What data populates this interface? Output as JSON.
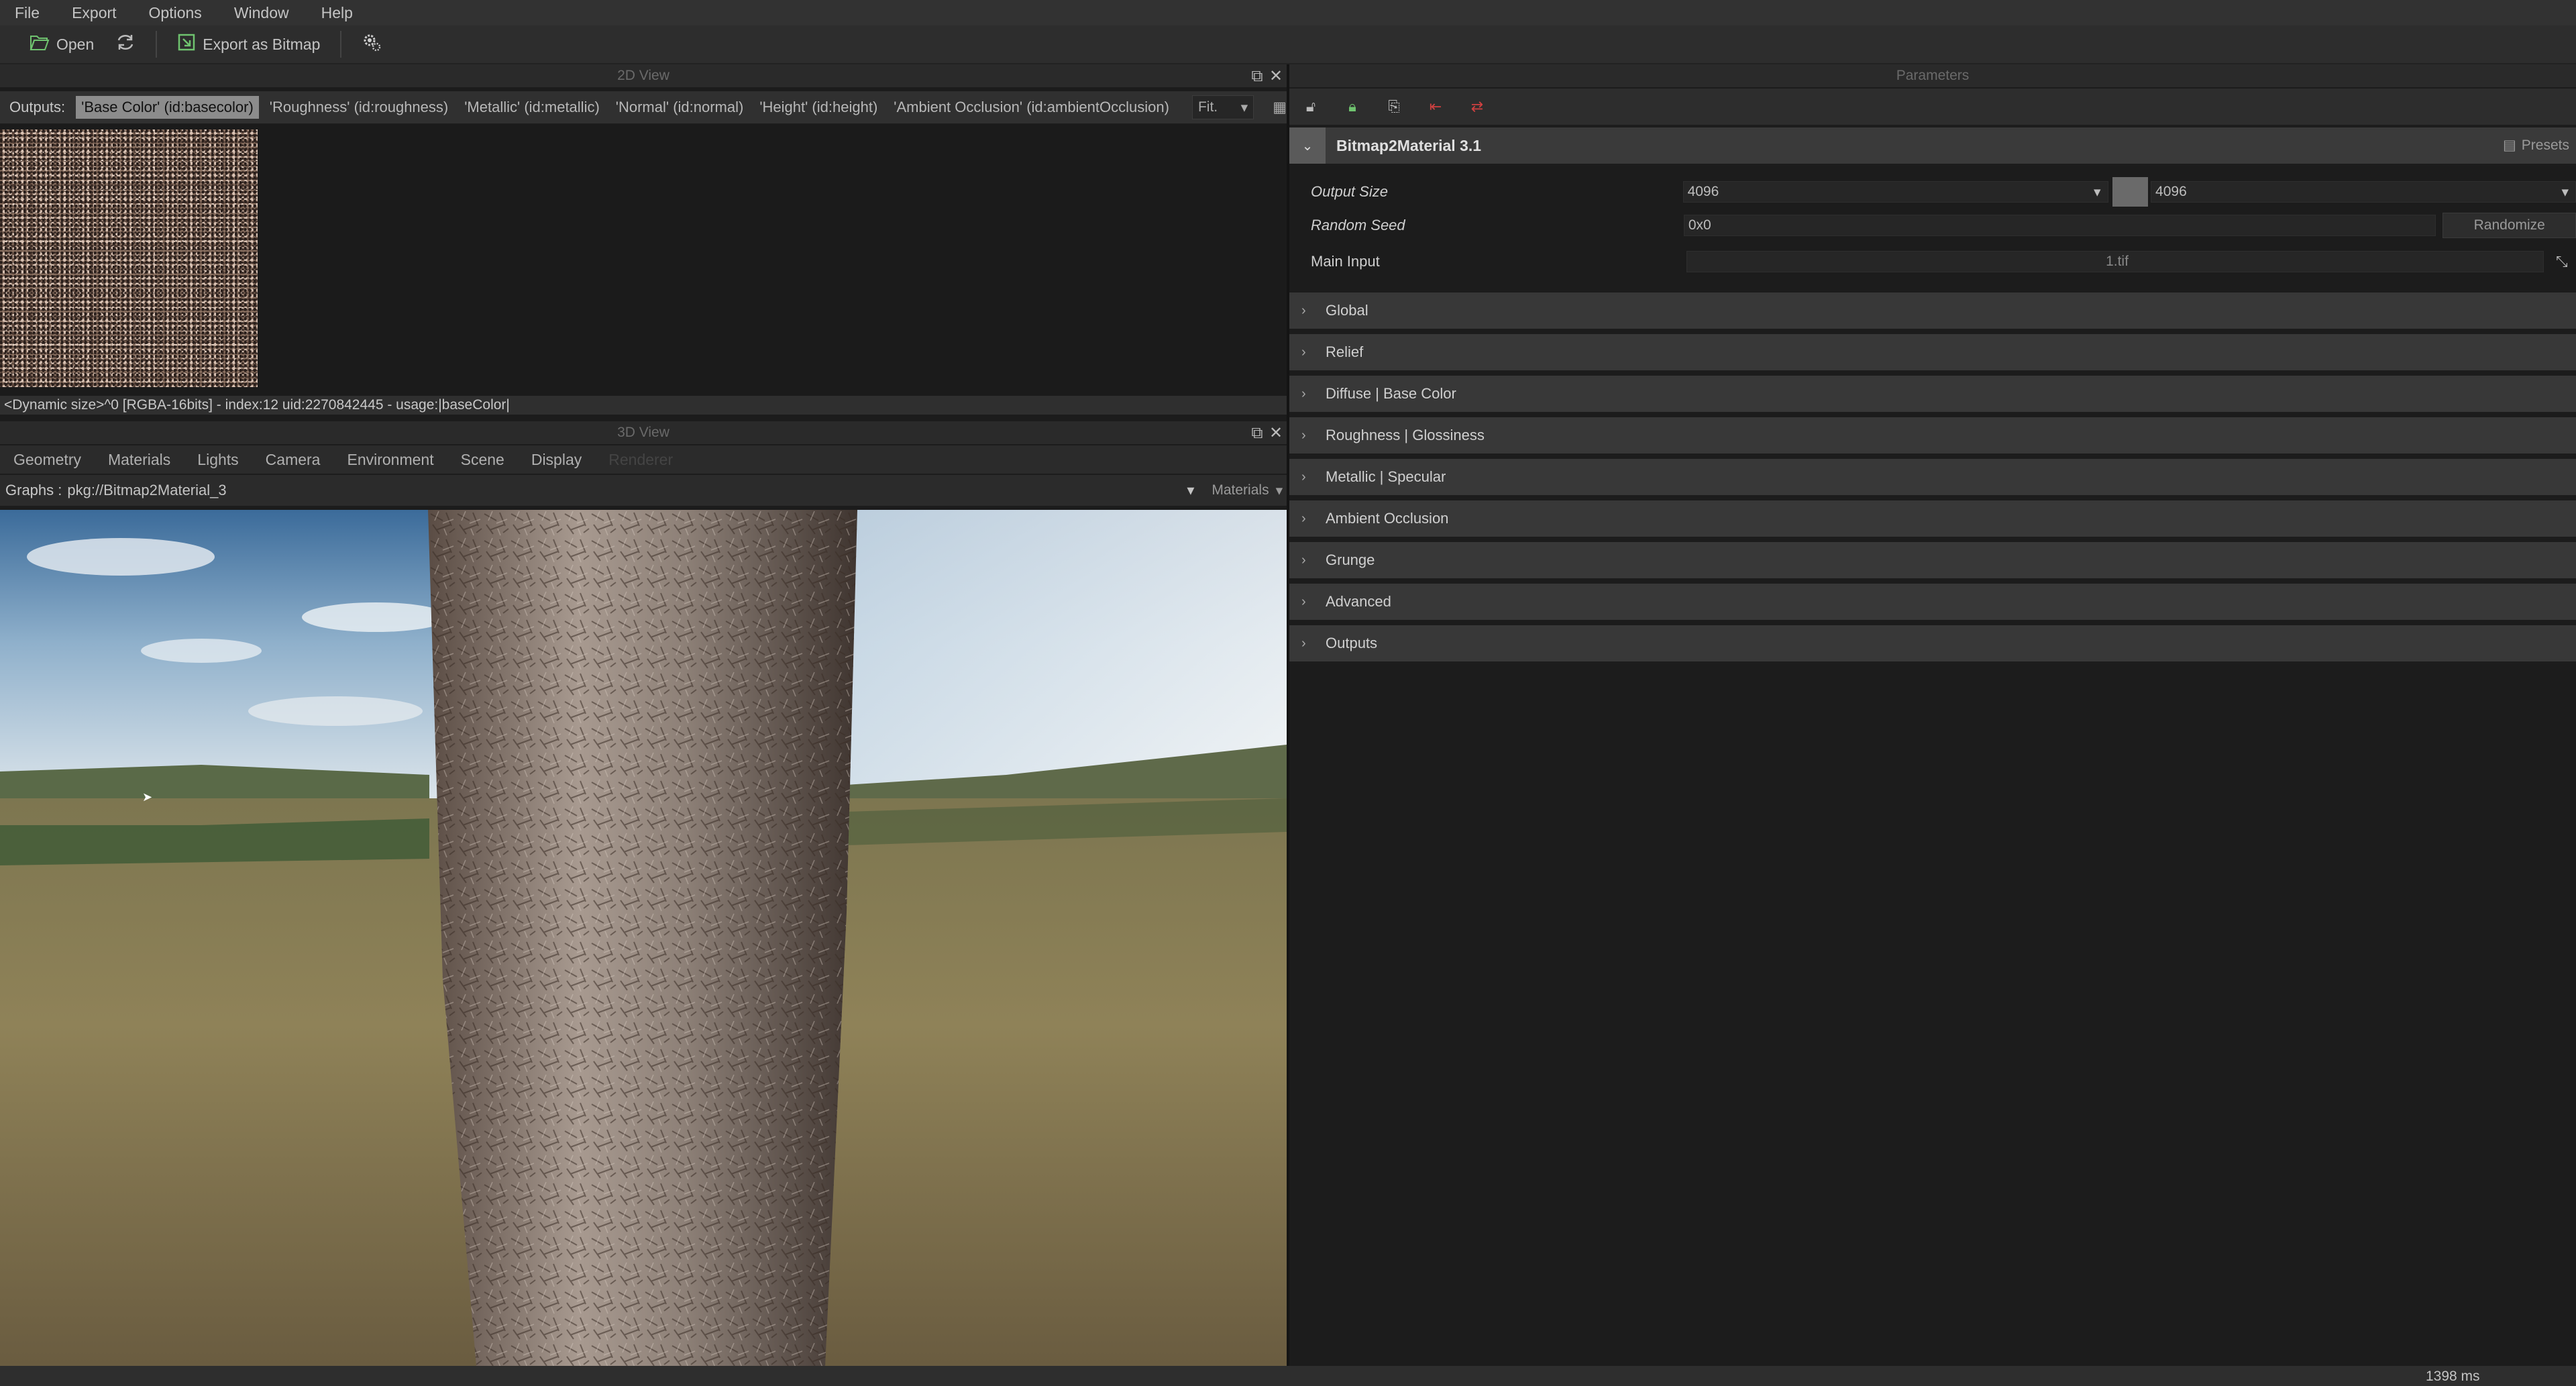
{
  "menu": [
    "File",
    "Export",
    "Options",
    "Window",
    "Help"
  ],
  "toolbar": {
    "open_label": "Open",
    "export_label": "Export as Bitmap"
  },
  "view2d": {
    "title": "2D View",
    "outputs_label": "Outputs:",
    "outputs": [
      "'Base Color' (id:basecolor)",
      "'Roughness' (id:roughness)",
      "'Metallic' (id:metallic)",
      "'Normal' (id:normal)",
      "'Height' (id:height)",
      "'Ambient Occlusion' (id:ambientOcclusion)"
    ],
    "fit": "Fit.",
    "info": "<Dynamic size>^0 [RGBA-16bits] - index:12 uid:2270842445 - usage:|baseColor|"
  },
  "view3d": {
    "title": "3D View",
    "tabs": [
      "Geometry",
      "Materials",
      "Lights",
      "Camera",
      "Environment",
      "Scene",
      "Display",
      "Renderer"
    ],
    "graphs_label": "Graphs :",
    "graph_value": "pkg://Bitmap2Material_3",
    "materials_label": "Materials"
  },
  "params": {
    "title": "Parameters",
    "graph_name": "Bitmap2Material 3.1",
    "presets_label": "Presets",
    "output_size_label": "Output Size",
    "output_size_w": "4096",
    "output_size_h": "4096",
    "random_seed_label": "Random Seed",
    "random_seed_value": "0x0",
    "randomize_label": "Randomize",
    "main_input_label": "Main Input",
    "main_input_value": "1.tif",
    "sections": [
      "Global",
      "Relief",
      "Diffuse | Base Color",
      "Roughness | Glossiness",
      "Metallic | Specular",
      "Ambient Occlusion",
      "Grunge",
      "Advanced",
      "Outputs"
    ]
  },
  "status": {
    "time": "1398 ms"
  },
  "colors": {
    "background": "#1c1c1c",
    "panel": "#383838",
    "accent_green": "#5fb85f",
    "accent_red": "#d04040"
  }
}
